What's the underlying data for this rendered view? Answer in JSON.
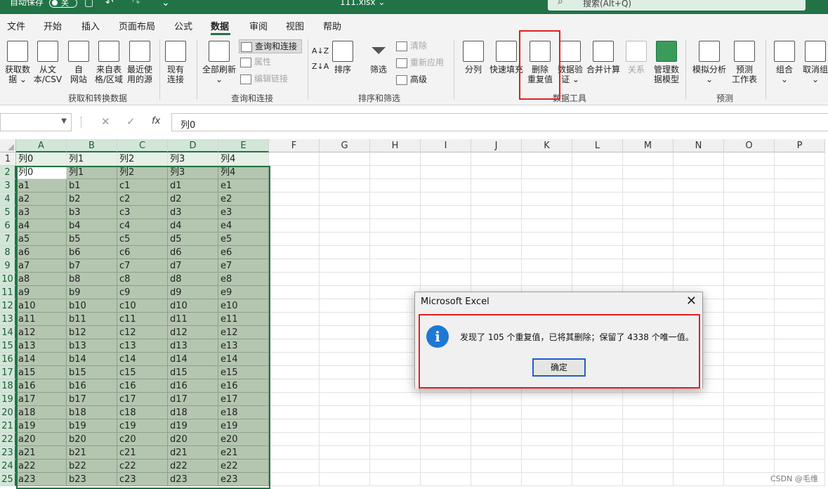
{
  "titlebar": {
    "autosave_label": "自动保存",
    "autosave_toggle": "关",
    "doc_title": "111.xlsx ⌄",
    "search_placeholder": "搜索(Alt+Q)"
  },
  "menu_tabs": [
    "文件",
    "开始",
    "插入",
    "页面布局",
    "公式",
    "数据",
    "审阅",
    "视图",
    "帮助"
  ],
  "active_tab": "数据",
  "ribbon": {
    "get_data": {
      "label1": "获取数",
      "label2": "据 ⌄"
    },
    "from_text": {
      "label1": "从文",
      "label2": "本/CSV"
    },
    "from_web": {
      "label1": "自",
      "label2": "网站"
    },
    "from_table": {
      "label1": "来自表",
      "label2": "格/区域"
    },
    "recent_sources": {
      "label1": "最近使",
      "label2": "用的源"
    },
    "existing_conn": {
      "label1": "现有",
      "label2": "连接"
    },
    "group_get_transform": "获取和转换数据",
    "refresh_all": {
      "label1": "全部刷新",
      "label2": "⌄"
    },
    "queries_conn": "查询和连接",
    "properties": "属性",
    "edit_links": "编辑链接",
    "group_queries": "查询和连接",
    "sort_label": "排序",
    "filter_label": "筛选",
    "clear_label": "清除",
    "reapply_label": "重新应用",
    "advanced_label": "高级",
    "group_sort_filter": "排序和筛选",
    "text_to_columns": "分列",
    "flash_fill": "快速填充",
    "remove_dup": {
      "label1": "删除",
      "label2": "重复值"
    },
    "data_validation": {
      "label1": "数据验",
      "label2": "证 ⌄"
    },
    "consolidate": "合并计算",
    "relationships": "关系",
    "manage_model": {
      "label1": "管理数",
      "label2": "据模型"
    },
    "group_data_tools": "数据工具",
    "whatif": {
      "label1": "模拟分析",
      "label2": "⌄"
    },
    "forecast": {
      "label1": "预测",
      "label2": "工作表"
    },
    "group_forecast": "预测",
    "group_btn": {
      "label1": "组合",
      "label2": "⌄"
    },
    "ungroup_btn": {
      "label1": "取消组",
      "label2": "⌄"
    }
  },
  "formula_bar": {
    "name_box": "",
    "fx": "fx",
    "value": "列0"
  },
  "columns": [
    "A",
    "B",
    "C",
    "D",
    "E",
    "F",
    "G",
    "H",
    "I",
    "J",
    "K",
    "L",
    "M",
    "N",
    "O",
    "P"
  ],
  "rows": [
    {
      "n": "1",
      "cells": [
        "列0",
        "列1",
        "列2",
        "列3",
        "列4"
      ]
    },
    {
      "n": "2",
      "cells": [
        "列0",
        "列1",
        "列2",
        "列3",
        "列4"
      ]
    },
    {
      "n": "3",
      "cells": [
        "a1",
        "b1",
        "c1",
        "d1",
        "e1"
      ]
    },
    {
      "n": "4",
      "cells": [
        "a2",
        "b2",
        "c2",
        "d2",
        "e2"
      ]
    },
    {
      "n": "5",
      "cells": [
        "a3",
        "b3",
        "c3",
        "d3",
        "e3"
      ]
    },
    {
      "n": "6",
      "cells": [
        "a4",
        "b4",
        "c4",
        "d4",
        "e4"
      ]
    },
    {
      "n": "7",
      "cells": [
        "a5",
        "b5",
        "c5",
        "d5",
        "e5"
      ]
    },
    {
      "n": "8",
      "cells": [
        "a6",
        "b6",
        "c6",
        "d6",
        "e6"
      ]
    },
    {
      "n": "9",
      "cells": [
        "a7",
        "b7",
        "c7",
        "d7",
        "e7"
      ]
    },
    {
      "n": "10",
      "cells": [
        "a8",
        "b8",
        "c8",
        "d8",
        "e8"
      ]
    },
    {
      "n": "11",
      "cells": [
        "a9",
        "b9",
        "c9",
        "d9",
        "e9"
      ]
    },
    {
      "n": "12",
      "cells": [
        "a10",
        "b10",
        "c10",
        "d10",
        "e10"
      ]
    },
    {
      "n": "13",
      "cells": [
        "a11",
        "b11",
        "c11",
        "d11",
        "e11"
      ]
    },
    {
      "n": "14",
      "cells": [
        "a12",
        "b12",
        "c12",
        "d12",
        "e12"
      ]
    },
    {
      "n": "15",
      "cells": [
        "a13",
        "b13",
        "c13",
        "d13",
        "e13"
      ]
    },
    {
      "n": "16",
      "cells": [
        "a14",
        "b14",
        "c14",
        "d14",
        "e14"
      ]
    },
    {
      "n": "17",
      "cells": [
        "a15",
        "b15",
        "c15",
        "d15",
        "e15"
      ]
    },
    {
      "n": "18",
      "cells": [
        "a16",
        "b16",
        "c16",
        "d16",
        "e16"
      ]
    },
    {
      "n": "19",
      "cells": [
        "a17",
        "b17",
        "c17",
        "d17",
        "e17"
      ]
    },
    {
      "n": "20",
      "cells": [
        "a18",
        "b18",
        "c18",
        "d18",
        "e18"
      ]
    },
    {
      "n": "21",
      "cells": [
        "a19",
        "b19",
        "c19",
        "d19",
        "e19"
      ]
    },
    {
      "n": "22",
      "cells": [
        "a20",
        "b20",
        "c20",
        "d20",
        "e20"
      ]
    },
    {
      "n": "23",
      "cells": [
        "a21",
        "b21",
        "c21",
        "d21",
        "e21"
      ]
    },
    {
      "n": "24",
      "cells": [
        "a22",
        "b22",
        "c22",
        "d22",
        "e22"
      ]
    },
    {
      "n": "25",
      "cells": [
        "a23",
        "b23",
        "c23",
        "d23",
        "e23"
      ]
    }
  ],
  "dialog": {
    "title": "Microsoft Excel",
    "close": "✕",
    "icon": "i",
    "message": "发现了 105 个重复值，已将其删除；保留了 4338 个唯一值。",
    "ok": "确定"
  },
  "watermark": "CSDN @毛维",
  "colors": {
    "excel_green": "#217346",
    "highlight_red": "#e02020",
    "selection_fill": "#b4c5b0",
    "info_blue": "#1e78d4"
  }
}
